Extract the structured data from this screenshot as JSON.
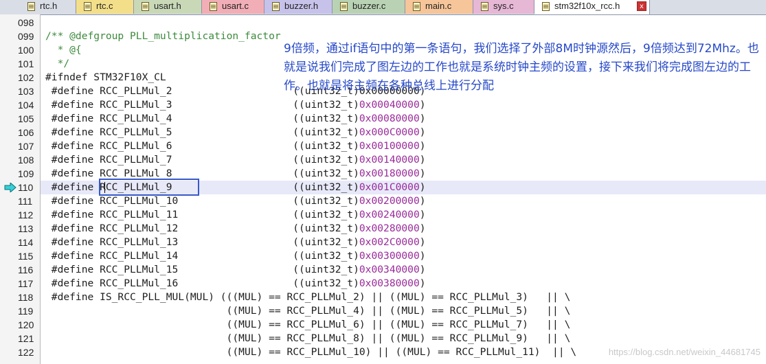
{
  "tabs": [
    {
      "label": "rtc.h",
      "color": "#d9dde6"
    },
    {
      "label": "rtc.c",
      "color": "#f3df8a"
    },
    {
      "label": "usart.h",
      "color": "#c9d9b8"
    },
    {
      "label": "usart.c",
      "color": "#f2aeb6"
    },
    {
      "label": "buzzer.h",
      "color": "#c7c2ea"
    },
    {
      "label": "buzzer.c",
      "color": "#b9d2b4"
    },
    {
      "label": "main.c",
      "color": "#f6c59a"
    },
    {
      "label": "sys.c",
      "color": "#e7b7d6"
    },
    {
      "label": "stm32f10x_rcc.h",
      "color": "#ffffff",
      "active": true,
      "close": "x"
    }
  ],
  "current_line": "110",
  "lines": [
    {
      "n": "098",
      "segs": [
        {
          "t": "",
          "c": ""
        }
      ]
    },
    {
      "n": "099",
      "segs": [
        {
          "t": "/** @defgroup PLL_multiplication_factor",
          "c": "cm"
        }
      ]
    },
    {
      "n": "100",
      "segs": [
        {
          "t": "  * @{",
          "c": "cm"
        }
      ]
    },
    {
      "n": "101",
      "segs": [
        {
          "t": "  */",
          "c": "cm"
        }
      ]
    },
    {
      "n": "102",
      "segs": [
        {
          "t": "#ifndef STM32F10X_CL",
          "c": "pp"
        }
      ]
    },
    {
      "n": "103",
      "segs": [
        {
          "t": " #define RCC_PLLMul_2                    ((uint32_t)0x00000000)",
          "c": "pp"
        }
      ]
    },
    {
      "n": "104",
      "segs": [
        {
          "t": " #define RCC_PLLMul_3                    ((uint32_t)",
          "c": "pp"
        },
        {
          "t": "0x00040000",
          "c": "hx"
        },
        {
          "t": ")",
          "c": "pp"
        }
      ]
    },
    {
      "n": "105",
      "segs": [
        {
          "t": " #define RCC_PLLMul_4                    ((uint32_t)",
          "c": "pp"
        },
        {
          "t": "0x00080000",
          "c": "hx"
        },
        {
          "t": ")",
          "c": "pp"
        }
      ]
    },
    {
      "n": "106",
      "segs": [
        {
          "t": " #define RCC_PLLMul_5                    ((uint32_t)",
          "c": "pp"
        },
        {
          "t": "0x000C0000",
          "c": "hx"
        },
        {
          "t": ")",
          "c": "pp"
        }
      ]
    },
    {
      "n": "107",
      "segs": [
        {
          "t": " #define RCC_PLLMul_6                    ((uint32_t)",
          "c": "pp"
        },
        {
          "t": "0x00100000",
          "c": "hx"
        },
        {
          "t": ")",
          "c": "pp"
        }
      ]
    },
    {
      "n": "108",
      "segs": [
        {
          "t": " #define RCC_PLLMul_7                    ((uint32_t)",
          "c": "pp"
        },
        {
          "t": "0x00140000",
          "c": "hx"
        },
        {
          "t": ")",
          "c": "pp"
        }
      ]
    },
    {
      "n": "109",
      "segs": [
        {
          "t": " #define RCC_PLLMul_8                    ((uint32_t)",
          "c": "pp"
        },
        {
          "t": "0x00180000",
          "c": "hx"
        },
        {
          "t": ")",
          "c": "pp"
        }
      ]
    },
    {
      "n": "110",
      "segs": [
        {
          "t": " #define RCC_PLLMul_9                    ((uint32_t)",
          "c": "pp"
        },
        {
          "t": "0x001C0000",
          "c": "hx"
        },
        {
          "t": ")",
          "c": "pp"
        }
      ]
    },
    {
      "n": "111",
      "segs": [
        {
          "t": " #define RCC_PLLMul_10                   ((uint32_t)",
          "c": "pp"
        },
        {
          "t": "0x00200000",
          "c": "hx"
        },
        {
          "t": ")",
          "c": "pp"
        }
      ]
    },
    {
      "n": "112",
      "segs": [
        {
          "t": " #define RCC_PLLMul_11                   ((uint32_t)",
          "c": "pp"
        },
        {
          "t": "0x00240000",
          "c": "hx"
        },
        {
          "t": ")",
          "c": "pp"
        }
      ]
    },
    {
      "n": "113",
      "segs": [
        {
          "t": " #define RCC_PLLMul_12                   ((uint32_t)",
          "c": "pp"
        },
        {
          "t": "0x00280000",
          "c": "hx"
        },
        {
          "t": ")",
          "c": "pp"
        }
      ]
    },
    {
      "n": "114",
      "segs": [
        {
          "t": " #define RCC_PLLMul_13                   ((uint32_t)",
          "c": "pp"
        },
        {
          "t": "0x002C0000",
          "c": "hx"
        },
        {
          "t": ")",
          "c": "pp"
        }
      ]
    },
    {
      "n": "115",
      "segs": [
        {
          "t": " #define RCC_PLLMul_14                   ((uint32_t)",
          "c": "pp"
        },
        {
          "t": "0x00300000",
          "c": "hx"
        },
        {
          "t": ")",
          "c": "pp"
        }
      ]
    },
    {
      "n": "116",
      "segs": [
        {
          "t": " #define RCC_PLLMul_15                   ((uint32_t)",
          "c": "pp"
        },
        {
          "t": "0x00340000",
          "c": "hx"
        },
        {
          "t": ")",
          "c": "pp"
        }
      ]
    },
    {
      "n": "117",
      "segs": [
        {
          "t": " #define RCC_PLLMul_16                   ((uint32_t)",
          "c": "pp"
        },
        {
          "t": "0x00380000",
          "c": "hx"
        },
        {
          "t": ")",
          "c": "pp"
        }
      ]
    },
    {
      "n": "118",
      "segs": [
        {
          "t": " #define IS_RCC_PLL_MUL(MUL) (((MUL) == RCC_PLLMul_2) || ((MUL) == RCC_PLLMul_3)   || \\",
          "c": "pp"
        }
      ]
    },
    {
      "n": "119",
      "segs": [
        {
          "t": "                              ((MUL) == RCC_PLLMul_4) || ((MUL) == RCC_PLLMul_5)   || \\",
          "c": "pp"
        }
      ]
    },
    {
      "n": "120",
      "segs": [
        {
          "t": "                              ((MUL) == RCC_PLLMul_6) || ((MUL) == RCC_PLLMul_7)   || \\",
          "c": "pp"
        }
      ]
    },
    {
      "n": "121",
      "segs": [
        {
          "t": "                              ((MUL) == RCC_PLLMul_8) || ((MUL) == RCC_PLLMul_9)   || \\",
          "c": "pp"
        }
      ]
    },
    {
      "n": "122",
      "segs": [
        {
          "t": "                              ((MUL) == RCC_PLLMul_10) || ((MUL) == RCC_PLLMul_11)  || \\",
          "c": "pp"
        }
      ]
    }
  ],
  "annotation": "9倍频，通过if语句中的第一条语句，我们选择了外部8M时钟源然后，9倍频达到72Mhz。也就是说我们完成了图左边的工作也就是系统时钟主频的设置，接下来我们将完成图左边的工作。也就是将主频在各种总线上进行分配",
  "watermark": "https://blog.csdn.net/weixin_44681745",
  "colors": {
    "comment": "#3c8a3c",
    "hex": "#9a2a9a",
    "annotation": "#2648c8",
    "selection": "#3559c9",
    "current_line_bg": "#e7e9f9"
  }
}
